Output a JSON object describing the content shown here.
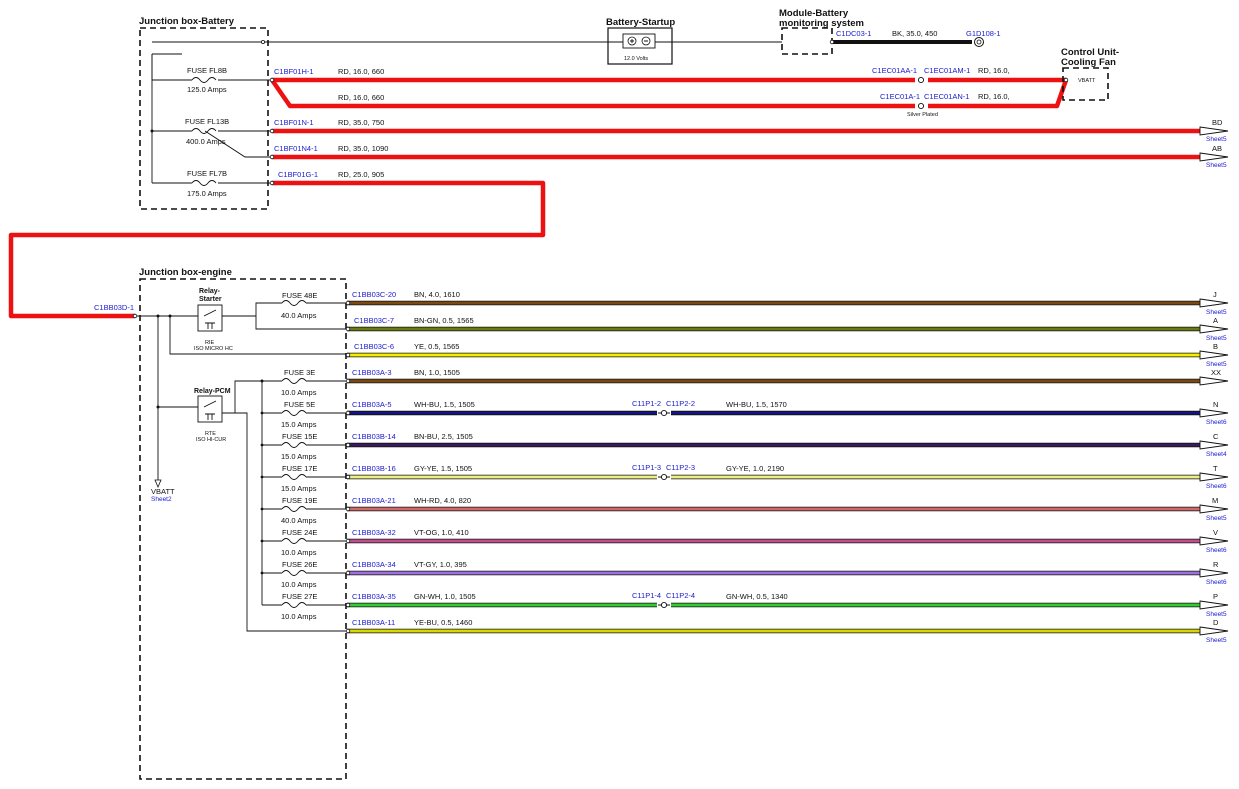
{
  "boxes": {
    "battery_jb": "Junction box-Battery",
    "engine_jb": "Junction box-engine",
    "battery_startup": "Battery-Startup",
    "battery_volts": "12.0 Volts",
    "module_bms_1": "Module-Battery",
    "module_bms_2": "monitoring system",
    "cooling_fan_1": "Control Unit-",
    "cooling_fan_2": "Cooling Fan",
    "vbatt": "VBATT"
  },
  "bms_wire": {
    "conn": "C1DC03-1",
    "spec": "BK,  35.0,  450",
    "ground": "G1D108-1"
  },
  "battery_fuses": [
    {
      "name": "FUSE FL8B",
      "rating": "125.0 Amps"
    },
    {
      "name": "FUSE FL13B",
      "rating": "400.0 Amps"
    },
    {
      "name": "FUSE FL7B",
      "rating": "175.0 Amps"
    }
  ],
  "battery_wires": [
    {
      "conn": "C1BF01H-1",
      "spec": "RD,  16.0,  660",
      "mid_a": "C1EC01AA-1",
      "mid_b": "C1EC01AM-1",
      "spec2": "RD,  16.0,"
    },
    {
      "conn": "",
      "spec": "RD,  16.0,  660",
      "mid_a": "C1EC01A-1",
      "mid_b": "C1EC01AN-1",
      "spec2": "RD,  16.0,",
      "note": "Silver Plated"
    },
    {
      "conn": "C1BF01N-1",
      "spec": "RD,  35.0,  750",
      "end": "BD",
      "sheet": "Sheet5"
    },
    {
      "conn": "C1BF01N4-1",
      "spec": "RD,  35.0,  1090",
      "end": "AB",
      "sheet": "Sheet5"
    },
    {
      "conn": "C1BF01G-1",
      "spec": "RD,  25.0,  905"
    }
  ],
  "engine_feed": "C1BB03D-1",
  "relays": {
    "starter_1": "Relay-",
    "starter_2": "Starter",
    "starter_type_1": "RIE",
    "starter_type_2": "ISO MICRO HC",
    "pcm": "Relay-PCM",
    "pcm_type_1": "RTE",
    "pcm_type_2": "ISO HI-CUR"
  },
  "vbatt_ref": {
    "label": "VBATT",
    "sheet": "Sheet2"
  },
  "engine_fuses": [
    {
      "name": "FUSE 48E",
      "rating": "40.0 Amps"
    },
    {
      "name": "FUSE 3E",
      "rating": "10.0 Amps"
    },
    {
      "name": "FUSE 5E",
      "rating": "15.0 Amps"
    },
    {
      "name": "FUSE 15E",
      "rating": "15.0 Amps"
    },
    {
      "name": "FUSE 17E",
      "rating": "15.0 Amps"
    },
    {
      "name": "FUSE 19E",
      "rating": "40.0 Amps"
    },
    {
      "name": "FUSE 24E",
      "rating": "10.0 Amps"
    },
    {
      "name": "FUSE 26E",
      "rating": "10.0 Amps"
    },
    {
      "name": "FUSE 27E",
      "rating": "10.0 Amps"
    }
  ],
  "engine_wires": [
    {
      "conn": "C1BB03C-20",
      "spec": "BN,  4.0,  1610",
      "end": "J",
      "sheet": "Sheet5",
      "color": "#7a4a12"
    },
    {
      "conn": "C1BB03C-7",
      "spec": "BN-GN,  0.5,  1565",
      "end": "A",
      "sheet": "Sheet5",
      "color": "#6a7a12"
    },
    {
      "conn": "C1BB03C-6",
      "spec": "YE,  0.5,  1565",
      "end": "B",
      "sheet": "Sheet5",
      "color": "#f2f200"
    },
    {
      "conn": "C1BB03A-3",
      "spec": "BN,  1.0,  1505",
      "end": "XX",
      "sheet": "",
      "color": "#7a4a12"
    },
    {
      "conn": "C1BB03A-5",
      "spec": "WH-BU,  1.5,  1505",
      "splice_a": "C11P1-2",
      "splice_b": "C11P2-2",
      "spec2": "WH-BU,  1.5,  1570",
      "end": "N",
      "sheet": "Sheet6",
      "color": "#14148a"
    },
    {
      "conn": "C1BB03B-14",
      "spec": "BN-BU,  2.5,  1505",
      "end": "C",
      "sheet": "Sheet4",
      "color": "#3a1a5a"
    },
    {
      "conn": "C1BB03B-16",
      "spec": "GY-YE,  1.5,  1505",
      "splice_a": "C11P1-3",
      "splice_b": "C11P2-3",
      "spec2": "GY-YE,  1.0,  2190",
      "end": "T",
      "sheet": "Sheet6",
      "color": "#eeee88"
    },
    {
      "conn": "C1BB03A-21",
      "spec": "WH-RD,  4.0,  820",
      "end": "M",
      "sheet": "Sheet5",
      "color": "#d06a6a"
    },
    {
      "conn": "C1BB03A-32",
      "spec": "VT-OG,  1.0,  410",
      "end": "V",
      "sheet": "Sheet6",
      "color": "#c24e90"
    },
    {
      "conn": "C1BB03A-34",
      "spec": "VT-GY,  1.0,  395",
      "end": "R",
      "sheet": "Sheet6",
      "color": "#a070e0"
    },
    {
      "conn": "C1BB03A-35",
      "spec": "GN-WH,  1.0,  1505",
      "splice_a": "C11P1-4",
      "splice_b": "C11P2-4",
      "spec2": "GN-WH,  0.5,  1340",
      "end": "P",
      "sheet": "Sheet5",
      "color": "#33cc33"
    },
    {
      "conn": "C1BB03A-11",
      "spec": "YE-BU,  0.5,  1460",
      "end": "D",
      "sheet": "Sheet5",
      "color": "#d8d800"
    }
  ]
}
